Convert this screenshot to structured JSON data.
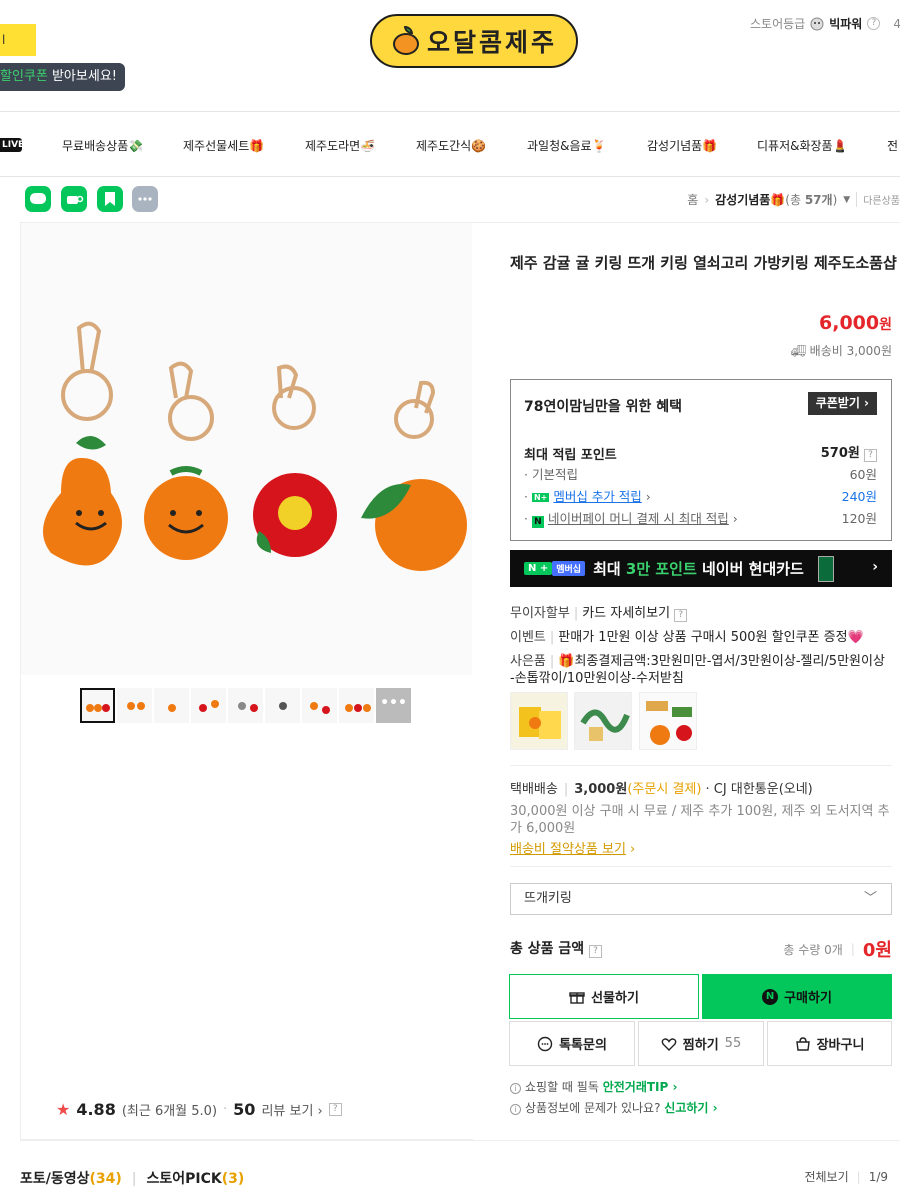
{
  "header": {
    "yellow_box": "l",
    "coupon_tip_highlight": "할인쿠폰",
    "coupon_tip_rest": " 받아보세요!",
    "logo_text": "오달콤제주",
    "grade_label": "스토어등급",
    "grade_value": "빅파워",
    "grade_help": "?",
    "grade_more": "4"
  },
  "nav": {
    "live": "LIVE",
    "items": [
      "무료배송상품💸",
      "제주선물세트🎁",
      "제주도라면🍜",
      "제주도간식🍪",
      "과일청&음료🍹",
      "감성기념품🎁",
      "디퓨저&화장품💄",
      "전"
    ]
  },
  "breadcrumb": {
    "home": "홈",
    "category": "감성기념품🎁",
    "count_prefix": "(총 ",
    "count": "57개",
    "count_suffix": ")",
    "other": "다른상품"
  },
  "product": {
    "title": "제주 감귤 귤 키링 뜨개 키링 열쇠고리 가방키링 제주도소품샵",
    "price": "6,000",
    "currency": "원",
    "shipping": "배송비 3,000원"
  },
  "benefit": {
    "title": "78연이맘님만을 위한 혜택",
    "coupon_button": "쿠폰받기 ›",
    "max_point_label": "최대 적립 포인트",
    "max_point_value": "570원",
    "basic_label": "기본적립",
    "basic_value": "60원",
    "member_label": "멤버십 추가 적립",
    "member_value": "240원",
    "npay_label": "네이버페이 머니 결제 시 최대 적립",
    "npay_value": "120원"
  },
  "banner": {
    "tag1": "N +",
    "tag2": "멤버십",
    "pre": "최대 ",
    "highlight": "3만 포인트",
    "post": " 네이버 현대카드"
  },
  "info": {
    "installment_label": "무이자할부",
    "installment_link": "카드 자세히보기",
    "event_label": "이벤트",
    "event_text": "판매가 1만원 이상 상품 구매시 500원 할인쿠폰 증정💗",
    "gift_label": "사은품",
    "gift_line1": "🎁최종결제금액:3만원미만-엽서/3만원이상-젤리/5만원이상",
    "gift_line2": "-손톱깎이/10만원이상-수저받침"
  },
  "delivery": {
    "label": "택배배송",
    "fee": "3,000원",
    "note": "(주문시 결제)",
    "carrier": "· CJ 대한통운(오네)",
    "cond_line1": "30,000원 이상 구매 시 무료 / 제주 추가 100원, 제주 외 도서지역 추",
    "cond_line2": "가 6,000원",
    "saving_link": "배송비 절약상품 보기"
  },
  "option": {
    "selected": "뜨개키링"
  },
  "total": {
    "label": "총 상품 금액",
    "qty_label": "총 수량 0개",
    "amount": "0원"
  },
  "buttons": {
    "gift": "선물하기",
    "buy": "구매하기",
    "inquiry": "톡톡문의",
    "wish": "찜하기",
    "wish_count": "55",
    "cart": "장바구니"
  },
  "notice": {
    "safe_pre": "쇼핑할 때 필독",
    "safe_link": "안전거래TIP ›",
    "report_pre": "상품정보에 문제가 있나요?",
    "report_link": "신고하기 ›"
  },
  "rating": {
    "score": "4.88",
    "recent": "(최근 6개월 5.0)",
    "review_count": "50",
    "review_link": "리뷰 보기 ›"
  },
  "bottom": {
    "photo_label": "포토/동영상",
    "photo_count": "(34)",
    "pick_label": "스토어PICK",
    "pick_count": "(3)",
    "view_all": "전체보기",
    "page": "1/9"
  },
  "colors": {
    "naver_green": "#03c75a",
    "price_red": "#e4262a",
    "logo_yellow": "#ffd83d",
    "nav_highlight": "#f39321"
  }
}
